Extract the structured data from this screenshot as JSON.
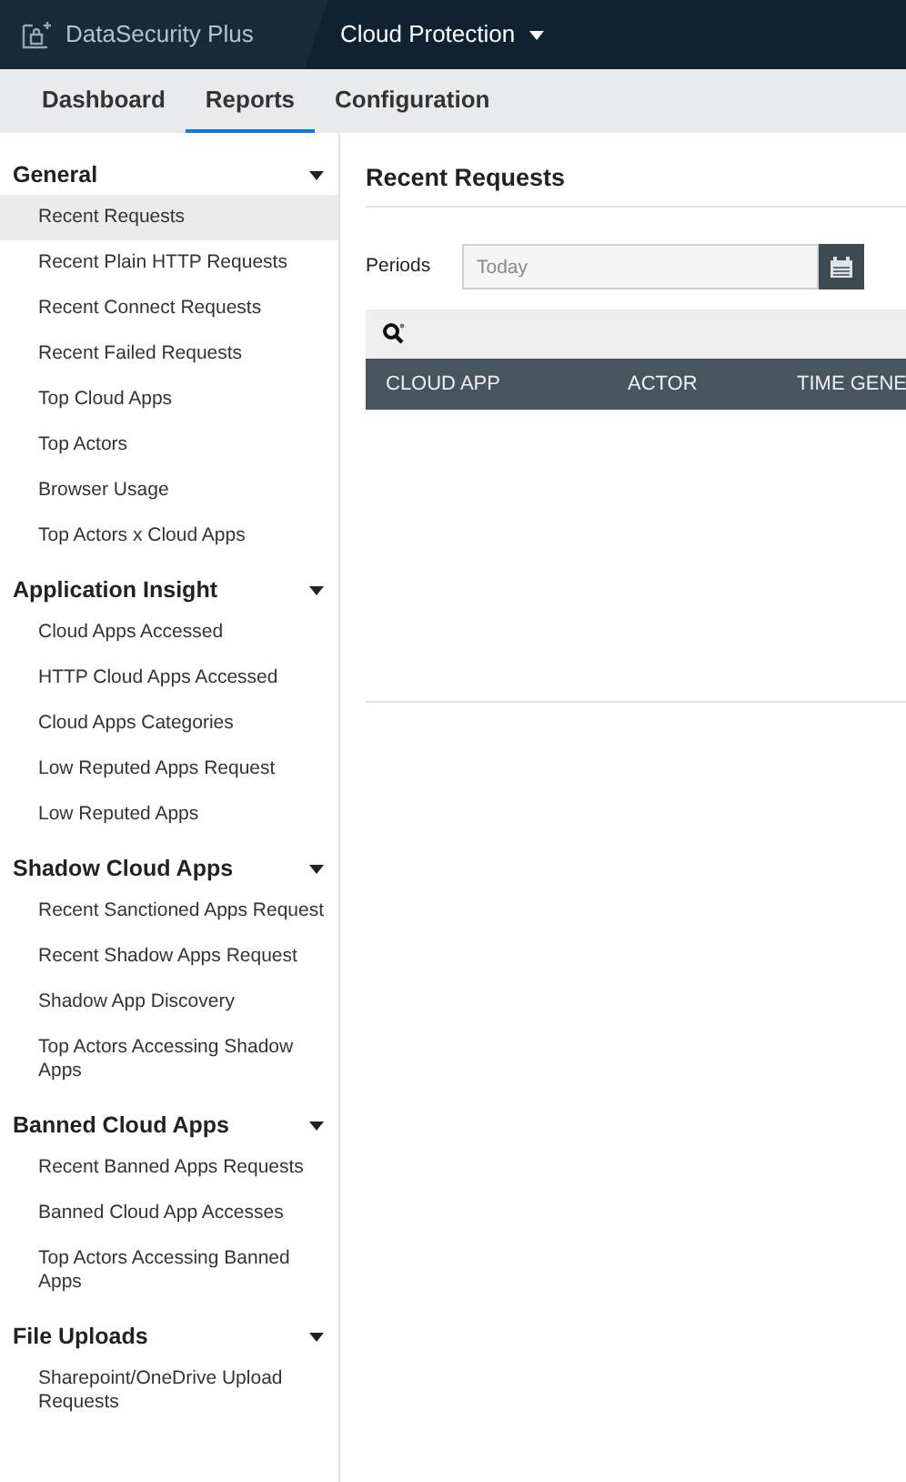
{
  "header": {
    "product": "DataSecurity Plus",
    "module": "Cloud Protection"
  },
  "tabs": [
    {
      "label": "Dashboard",
      "selected": false
    },
    {
      "label": "Reports",
      "selected": true
    },
    {
      "label": "Configuration",
      "selected": false
    }
  ],
  "sidebar": {
    "sections": [
      {
        "title": "General",
        "expanded": true,
        "items": [
          {
            "label": "Recent Requests",
            "selected": true
          },
          {
            "label": "Recent Plain HTTP Requests",
            "selected": false
          },
          {
            "label": "Recent Connect Requests",
            "selected": false
          },
          {
            "label": "Recent Failed Requests",
            "selected": false
          },
          {
            "label": "Top Cloud Apps",
            "selected": false
          },
          {
            "label": "Top Actors",
            "selected": false
          },
          {
            "label": "Browser Usage",
            "selected": false
          },
          {
            "label": "Top Actors x Cloud Apps",
            "selected": false
          }
        ]
      },
      {
        "title": "Application Insight",
        "expanded": true,
        "items": [
          {
            "label": "Cloud Apps Accessed",
            "selected": false
          },
          {
            "label": "HTTP Cloud Apps Accessed",
            "selected": false
          },
          {
            "label": "Cloud Apps Categories",
            "selected": false
          },
          {
            "label": "Low Reputed Apps Request",
            "selected": false
          },
          {
            "label": "Low Reputed Apps",
            "selected": false
          }
        ]
      },
      {
        "title": "Shadow Cloud Apps",
        "expanded": true,
        "items": [
          {
            "label": "Recent Sanctioned Apps Request",
            "selected": false
          },
          {
            "label": "Recent Shadow Apps Request",
            "selected": false
          },
          {
            "label": "Shadow App Discovery",
            "selected": false
          },
          {
            "label": "Top Actors Accessing Shadow Apps",
            "selected": false
          }
        ]
      },
      {
        "title": "Banned Cloud Apps",
        "expanded": true,
        "items": [
          {
            "label": "Recent Banned Apps Requests",
            "selected": false
          },
          {
            "label": "Banned Cloud App Accesses",
            "selected": false
          },
          {
            "label": "Top Actors Accessing Banned Apps",
            "selected": false
          }
        ]
      },
      {
        "title": "File Uploads",
        "expanded": true,
        "items": [
          {
            "label": "Sharepoint/OneDrive Upload Requests",
            "selected": false
          }
        ]
      }
    ]
  },
  "report": {
    "title": "Recent Requests",
    "period_label": "Periods",
    "period_field": {
      "placeholder": "Today"
    },
    "table": {
      "columns": [
        "CLOUD APP",
        "ACTOR",
        "TIME GENE"
      ]
    }
  }
}
